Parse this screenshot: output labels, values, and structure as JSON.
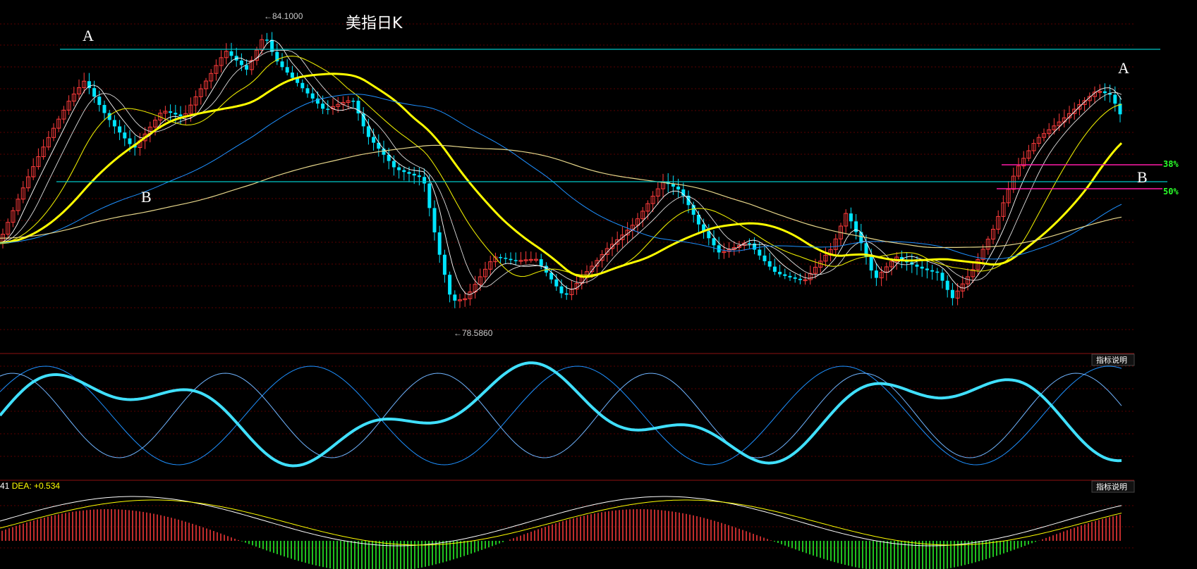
{
  "chart_data": [
    {
      "type": "candlestick",
      "title": "美指日K",
      "annotations": {
        "high_label": "84.1000",
        "low_label": "78.5860",
        "points": [
          "A",
          "B",
          "A",
          "B"
        ],
        "fib": [
          {
            "label": "38%"
          },
          {
            "label": "50%"
          }
        ]
      },
      "colors": {
        "up": "#ff3b3b",
        "down": "#00e5ff",
        "ma_thick": "#ffff00",
        "ma_long": "#1e90ff",
        "ma_vlong": "#e6d68a",
        "ma_short": "#ffffff",
        "level_line": "#00c8c8",
        "fib_line": "#ff1aa8"
      }
    },
    {
      "type": "line",
      "panel": "oscillator",
      "button_label": "指标说明",
      "colors": {
        "main": "#40e0ff",
        "thin": "#1e90ff"
      }
    },
    {
      "type": "bar",
      "panel": "MACD",
      "button_label": "指标说明",
      "label_prefix": "41",
      "dea_label": "DEA: +0.534",
      "colors": {
        "positive": "#ff3b3b",
        "negative": "#2aff2a",
        "dif": "#ffffff",
        "dea": "#ffff00"
      }
    }
  ]
}
